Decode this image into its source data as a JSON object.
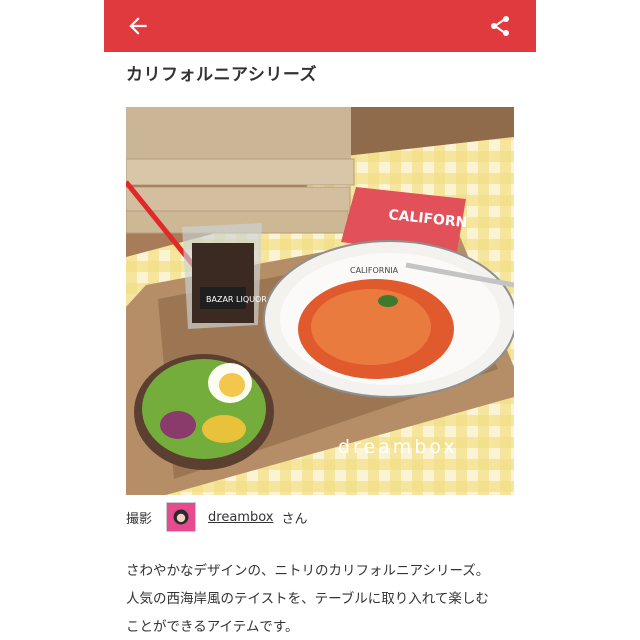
{
  "appbar": {
    "back_icon": "arrow-left-icon",
    "share_icon": "share-icon",
    "color": "#e03a3e"
  },
  "article": {
    "title": "カリフォルニアシリーズ",
    "photo": {
      "watermark": "dreambox",
      "napkin_text": "CALIFORN",
      "plate_logo": "CALIFORNIA",
      "glass_text": "BAZAR LIQUOR"
    },
    "credit": {
      "label": "撮影",
      "username": "dreambox",
      "suffix": "さん"
    },
    "body_lines": [
      "さわやかなデザインの、ニトリのカリフォルニアシリーズ。",
      "人気の西海岸風のテイストを、テーブルに取り入れて楽しむ",
      "ことができるアイテムです。"
    ]
  }
}
